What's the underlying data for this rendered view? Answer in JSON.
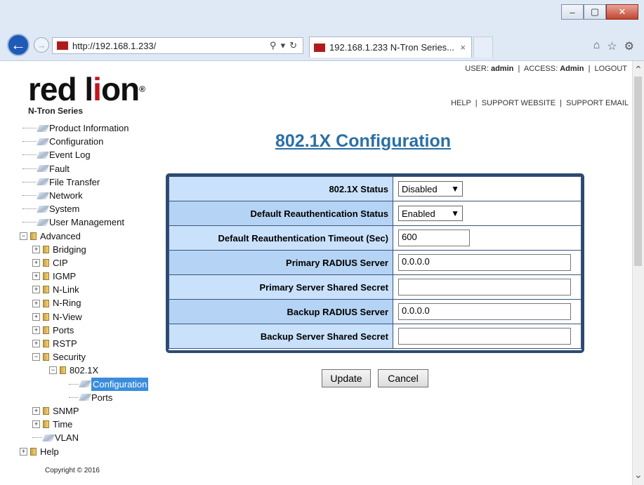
{
  "browser": {
    "url": "http://192.168.1.233/",
    "tab_title": "192.168.1.233 N-Tron Series...",
    "tab_close": "×",
    "search_icon": "search-icon",
    "refresh_icon": "refresh-icon"
  },
  "brand": {
    "logo_text_pre": "red l",
    "logo_text_lion": "i",
    "logo_text_post": "on",
    "registered": "®",
    "subtitle": "N-Tron Series"
  },
  "session": {
    "user_label": "USER:",
    "user": "admin",
    "access_label": "ACCESS:",
    "access": "Admin",
    "logout": "LOGOUT"
  },
  "links": {
    "help": "HELP",
    "support_website": "SUPPORT WEBSITE",
    "support_email": "SUPPORT EMAIL"
  },
  "nav": {
    "product_information": "Product Information",
    "configuration": "Configuration",
    "event_log": "Event Log",
    "fault": "Fault",
    "file_transfer": "File Transfer",
    "network": "Network",
    "system": "System",
    "user_management": "User Management",
    "advanced": "Advanced",
    "bridging": "Bridging",
    "cip": "CIP",
    "igmp": "IGMP",
    "nlink": "N-Link",
    "nring": "N-Ring",
    "nview": "N-View",
    "ports": "Ports",
    "rstp": "RSTP",
    "security": "Security",
    "dot1x": "802.1X",
    "dot1x_configuration": "Configuration",
    "dot1x_ports": "Ports",
    "snmp": "SNMP",
    "time": "Time",
    "vlan": "VLAN",
    "help": "Help"
  },
  "page": {
    "title": "802.1X Configuration"
  },
  "form": {
    "status_label": "802.1X Status",
    "status_value": "Disabled",
    "reauth_status_label": "Default Reauthentication Status",
    "reauth_status_value": "Enabled",
    "reauth_timeout_label": "Default Reauthentication Timeout (Sec)",
    "reauth_timeout_value": "600",
    "primary_server_label": "Primary RADIUS Server",
    "primary_server_value": "0.0.0.0",
    "primary_secret_label": "Primary Server Shared Secret",
    "primary_secret_value": "",
    "backup_server_label": "Backup RADIUS Server",
    "backup_server_value": "0.0.0.0",
    "backup_secret_label": "Backup Server Shared Secret",
    "backup_secret_value": ""
  },
  "buttons": {
    "update": "Update",
    "cancel": "Cancel"
  },
  "footer": {
    "copyright": "Copyright © 2016"
  }
}
